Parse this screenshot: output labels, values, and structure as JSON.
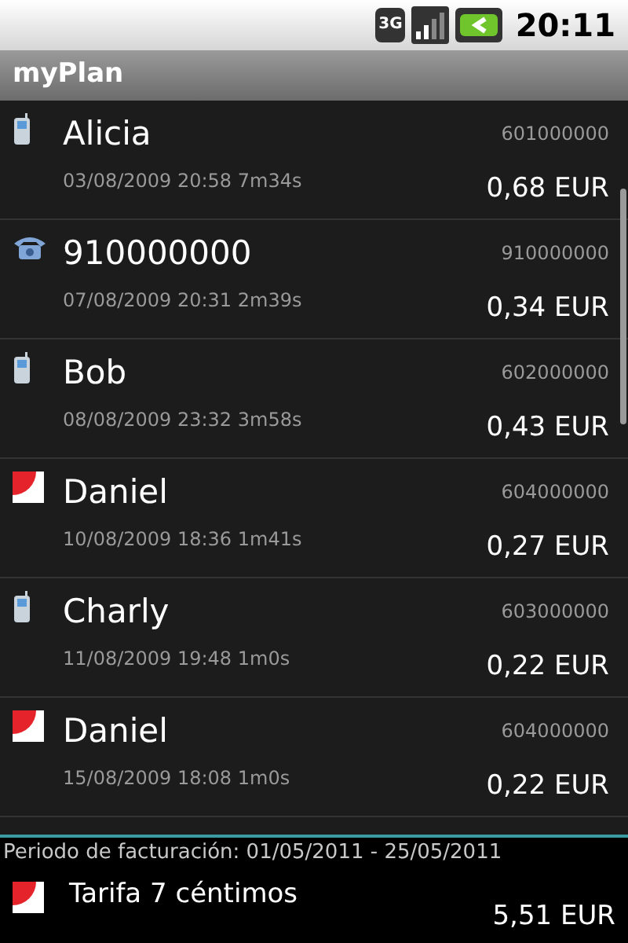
{
  "status_bar": {
    "network": "3G",
    "time": "20:11"
  },
  "window": {
    "title": "myPlan"
  },
  "calls": [
    {
      "kind": "mobile",
      "name": "Alicia",
      "number": "601000000",
      "details": "03/08/2009 20:58 7m34s",
      "cost": "0,68 EUR"
    },
    {
      "kind": "landline",
      "name": "910000000",
      "number": "910000000",
      "details": "07/08/2009 20:31 2m39s",
      "cost": "0,34 EUR"
    },
    {
      "kind": "mobile",
      "name": "Bob",
      "number": "602000000",
      "details": "08/08/2009 23:32 3m58s",
      "cost": "0,43 EUR"
    },
    {
      "kind": "operator",
      "name": "Daniel",
      "number": "604000000",
      "details": "10/08/2009 18:36 1m41s",
      "cost": "0,27 EUR"
    },
    {
      "kind": "mobile",
      "name": "Charly",
      "number": "603000000",
      "details": "11/08/2009 19:48 1m0s",
      "cost": "0,22 EUR"
    },
    {
      "kind": "operator",
      "name": "Daniel",
      "number": "604000000",
      "details": "15/08/2009 18:08 1m0s",
      "cost": "0,22 EUR"
    }
  ],
  "footer": {
    "period": "Periodo de facturación: 01/05/2011 - 25/05/2011",
    "plan": {
      "kind": "operator",
      "name": "Tarifa 7 céntimos",
      "total": "5,51 EUR"
    }
  }
}
